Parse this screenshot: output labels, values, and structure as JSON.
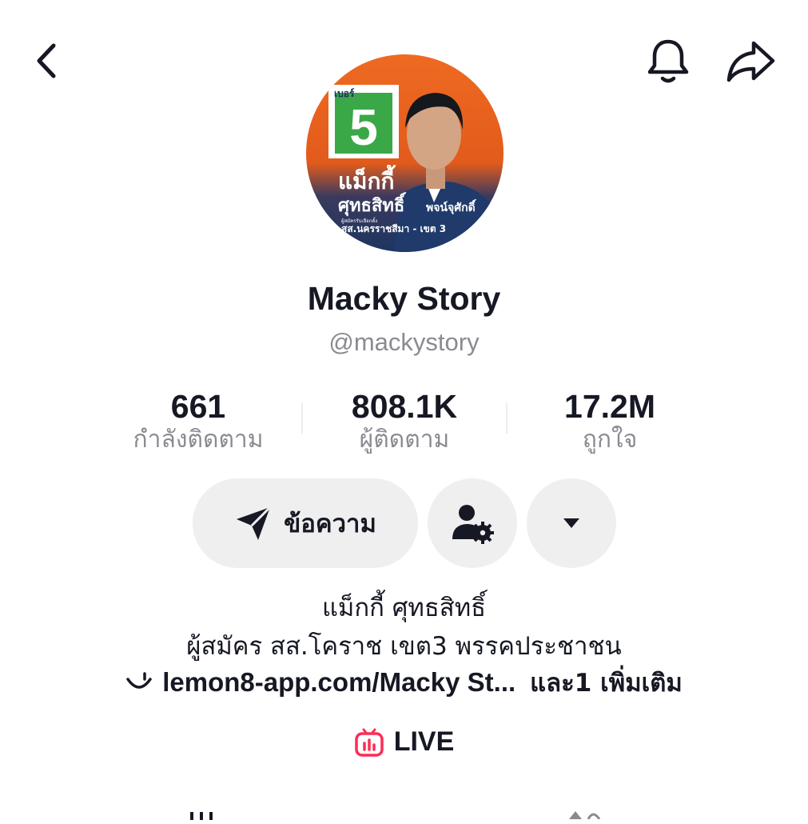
{
  "profile": {
    "display_name": "Macky Story",
    "handle": "@mackystory"
  },
  "avatar": {
    "badge_label": "เบอร์",
    "number": "5",
    "name_line1": "แม็กกี้",
    "name_line2": "ศุทธสิทธิ์",
    "surname": "พจน์จุศักดิ์",
    "caption_small": "ผู้สมัครรับเลือกตั้ง",
    "district": "สส.นครราชสีมา - เขต 3",
    "colors": {
      "orange": "#e8631f",
      "navy": "#1d3560",
      "green": "#3aa847"
    }
  },
  "stats": [
    {
      "value": "661",
      "label": "กำลังติดตาม"
    },
    {
      "value": "808.1K",
      "label": "ผู้ติดตาม"
    },
    {
      "value": "17.2M",
      "label": "ถูกใจ"
    }
  ],
  "actions": {
    "message_label": "ข้อความ"
  },
  "bio": {
    "line1": "แม็กกี้ ศุทธสิทธิ์",
    "line2": "ผู้สมัคร สส.โคราช เขต3 พรรคประชาชน",
    "link_icon": "lemon8-smile-icon",
    "link_text": "lemon8-app.com/Macky St...",
    "more_text": "และ1 เพิ่มเติม"
  },
  "live": {
    "label": "LIVE",
    "color": "#fe2c55"
  },
  "icons": {
    "back": "chevron-left-icon",
    "bell": "bell-icon",
    "share": "share-arrow-icon",
    "send": "send-icon",
    "user_settings": "user-gear-icon",
    "dropdown": "caret-down-icon"
  }
}
